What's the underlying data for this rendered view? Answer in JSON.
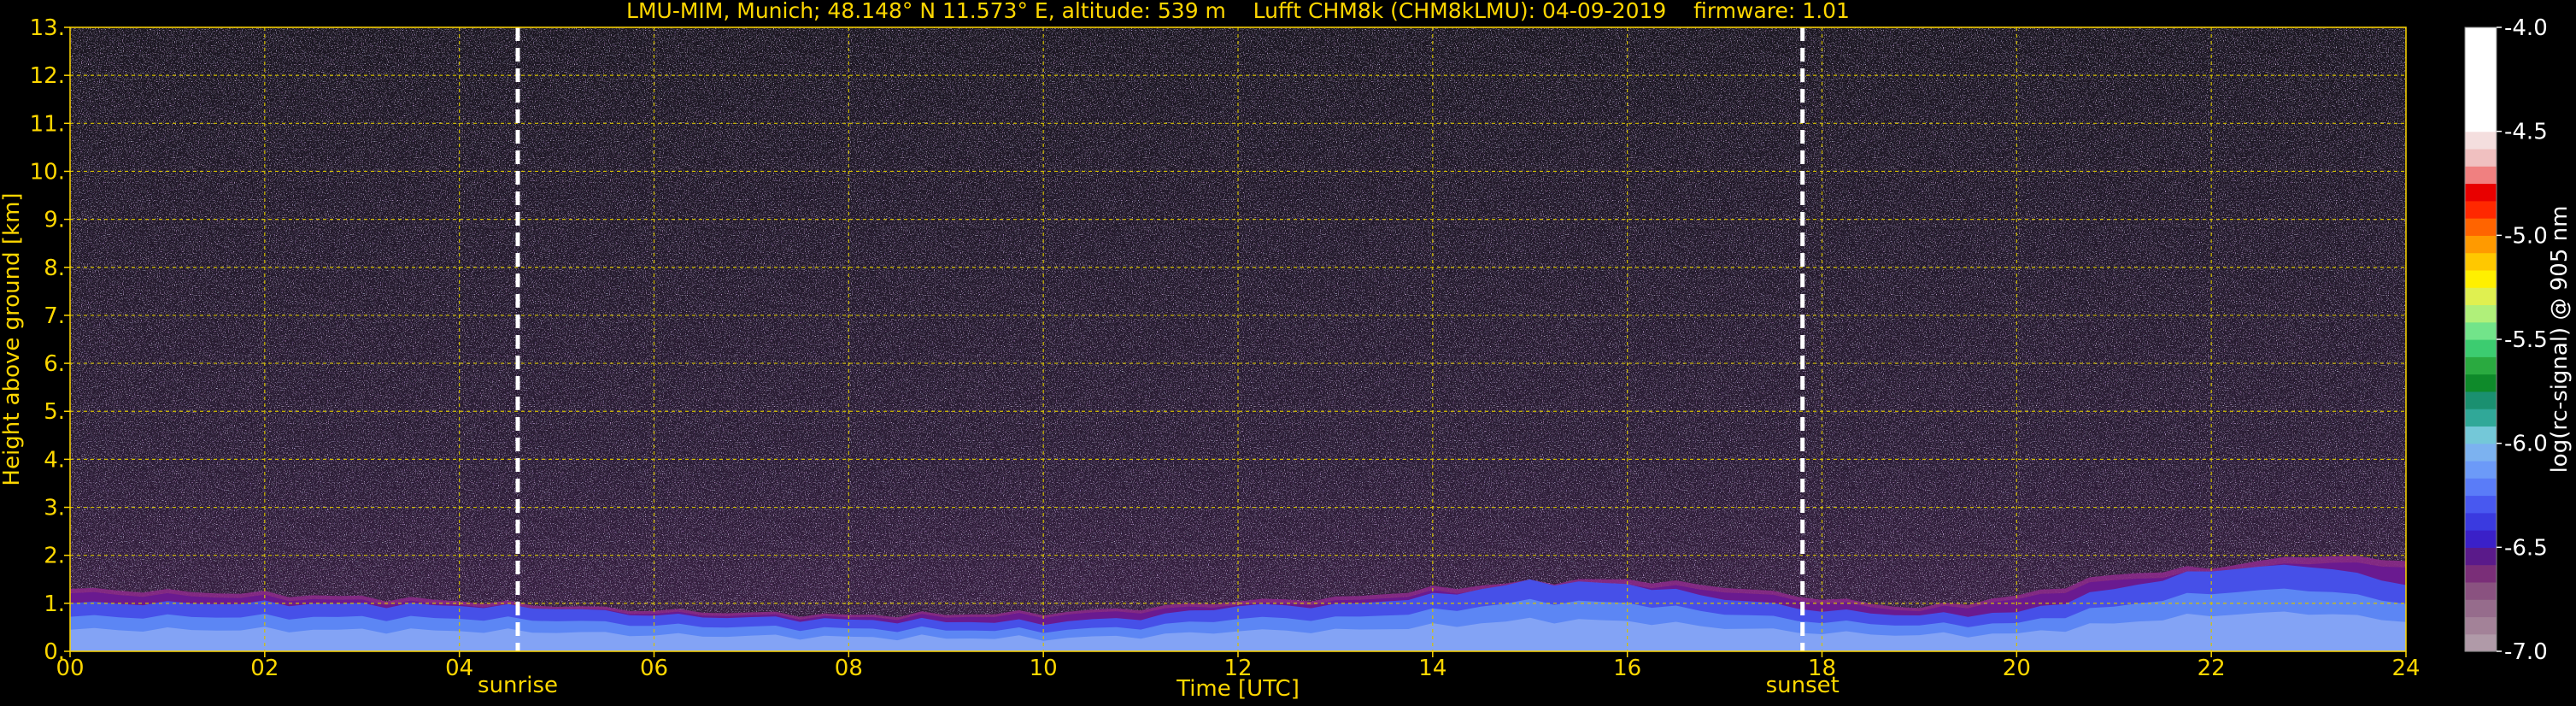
{
  "chart_data": {
    "type": "heatmap",
    "title": "LMU-MIM, Munich; 48.148° N 11.573° E, altitude: 539 m    Lufft CHM8k (CHM8kLMU): 04-09-2019    firmware: 1.01",
    "xlabel": "Time [UTC]",
    "ylabel": "Height above ground [km]",
    "xlim": [
      0,
      24
    ],
    "ylim": [
      0,
      13
    ],
    "x_ticks": [
      "00",
      "02",
      "04",
      "06",
      "08",
      "10",
      "12",
      "14",
      "16",
      "18",
      "20",
      "22",
      "24"
    ],
    "y_ticks": [
      "0.",
      "1.",
      "2.",
      "3.",
      "4.",
      "5.",
      "6.",
      "7.",
      "8.",
      "9.",
      "10.",
      "11.",
      "12.",
      "13."
    ],
    "grid": true,
    "markers": [
      {
        "label": "sunrise",
        "time_utc": 4.6
      },
      {
        "label": "sunset",
        "time_utc": 17.8
      }
    ],
    "colorbar": {
      "label": "log(rc-signal) @ 905 nm",
      "range": [
        -7.0,
        -4.0
      ],
      "ticks": [
        "-4.0",
        "-4.5",
        "-5.0",
        "-5.5",
        "-6.0",
        "-6.5",
        "-7.0"
      ],
      "colors": [
        "#b09aa8",
        "#a38298",
        "#966c8c",
        "#8a5280",
        "#7a2e78",
        "#5a1a8a",
        "#3a20c8",
        "#3a3ae0",
        "#4858f0",
        "#5a7cf8",
        "#6c9af8",
        "#7cb2f0",
        "#74c8d8",
        "#30a898",
        "#1a9070",
        "#0e8a2a",
        "#2aaa40",
        "#3ccc70",
        "#72e48a",
        "#b0f07a",
        "#e0f050",
        "#fff000",
        "#ffc800",
        "#ff9a00",
        "#ff6400",
        "#ff2800",
        "#e80000",
        "#f08080",
        "#f0c0c0",
        "#f4dede",
        "#ffffff",
        "#ffffff",
        "#ffffff",
        "#ffffff",
        "#ffffff",
        "#ffffff"
      ]
    },
    "boundary_layer_top_km": [
      [
        0,
        1.3
      ],
      [
        2,
        1.2
      ],
      [
        4,
        1.05
      ],
      [
        5,
        0.95
      ],
      [
        6,
        0.85
      ],
      [
        8,
        0.75
      ],
      [
        10,
        0.8
      ],
      [
        11,
        0.9
      ],
      [
        12,
        1.05
      ],
      [
        13,
        1.1
      ],
      [
        14,
        1.3
      ],
      [
        15,
        1.45
      ],
      [
        16,
        1.5
      ],
      [
        17,
        1.35
      ],
      [
        18,
        1.1
      ],
      [
        19,
        0.9
      ],
      [
        20,
        1.15
      ],
      [
        21,
        1.6
      ],
      [
        22,
        1.75
      ],
      [
        23,
        2.0
      ],
      [
        24,
        1.9
      ]
    ],
    "aerosol_layer_top_km": [
      [
        0,
        1.0
      ],
      [
        2,
        1.0
      ],
      [
        4,
        0.95
      ],
      [
        5,
        0.9
      ],
      [
        6,
        0.75
      ],
      [
        8,
        0.65
      ],
      [
        10,
        0.6
      ],
      [
        11,
        0.7
      ],
      [
        12,
        0.95
      ],
      [
        13,
        0.95
      ],
      [
        14,
        1.15
      ],
      [
        15,
        1.45
      ],
      [
        16,
        1.4
      ],
      [
        17,
        1.1
      ],
      [
        18,
        0.85
      ],
      [
        19,
        0.75
      ],
      [
        20,
        0.8
      ],
      [
        21,
        1.3
      ],
      [
        22,
        1.7
      ],
      [
        23,
        1.8
      ],
      [
        24,
        1.4
      ]
    ]
  }
}
